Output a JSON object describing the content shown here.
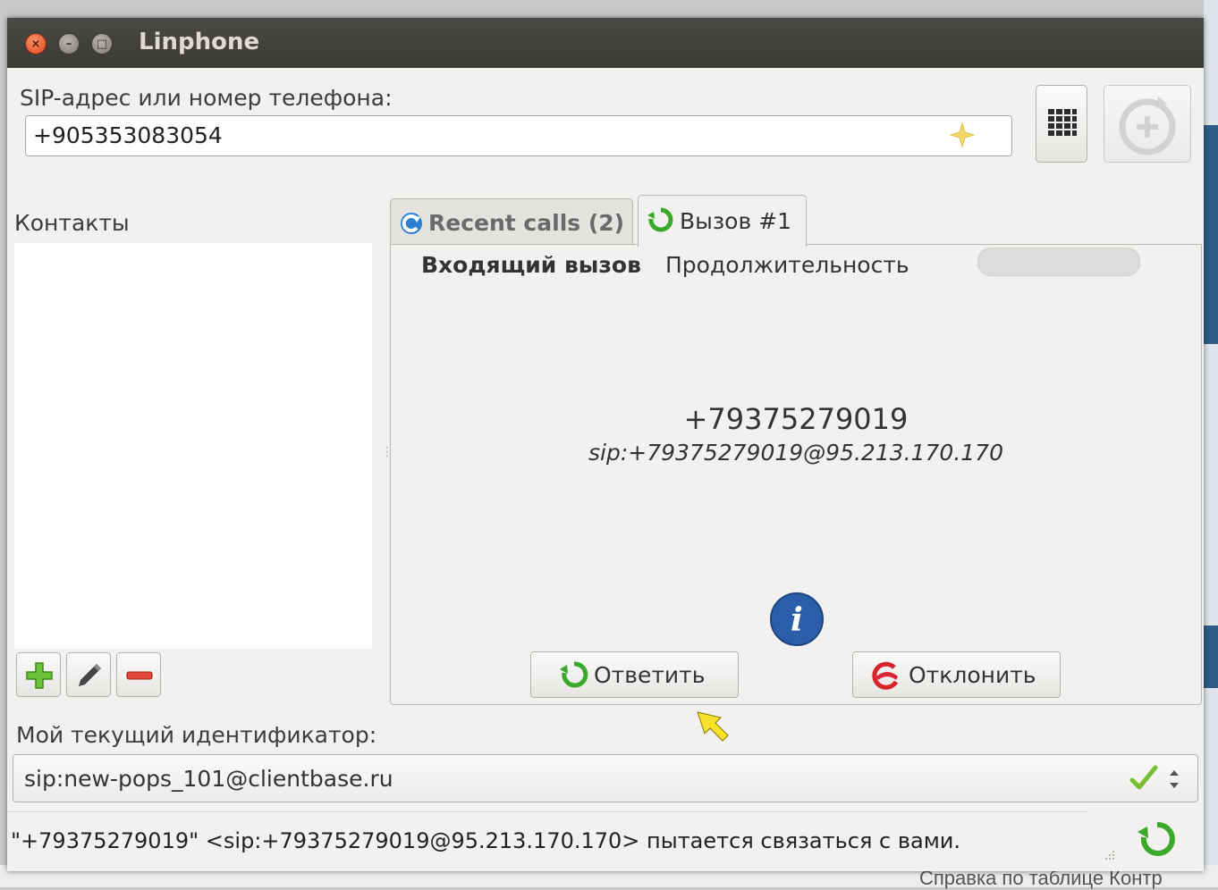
{
  "window": {
    "title": "Linphone"
  },
  "sip": {
    "label": "SIP-адрес или номер телефона:",
    "value": "+905353083054"
  },
  "contacts": {
    "label": "Контакты"
  },
  "tabs": [
    {
      "label": "Recent calls (2)"
    },
    {
      "label": "Вызов #1"
    }
  ],
  "call": {
    "state": "Входящий вызов",
    "duration_label": "Продолжительность",
    "number": "+79375279019",
    "sip_uri": "sip:+79375279019@95.213.170.170",
    "answer_label": "Ответить",
    "decline_label": "Отклонить"
  },
  "identity": {
    "label": "Мой текущий идентификатор:",
    "value": "sip:new-pops_101@clientbase.ru"
  },
  "status": {
    "message": "\"+79375279019\" <sip:+79375279019@95.213.170.170> пытается связаться с вами."
  },
  "background": {
    "bottom_text": "Справка по таблице   Контр"
  },
  "colors": {
    "accent_green": "#3aa82a",
    "decline_red": "#d8242c",
    "info_blue": "#2b5ea8"
  }
}
